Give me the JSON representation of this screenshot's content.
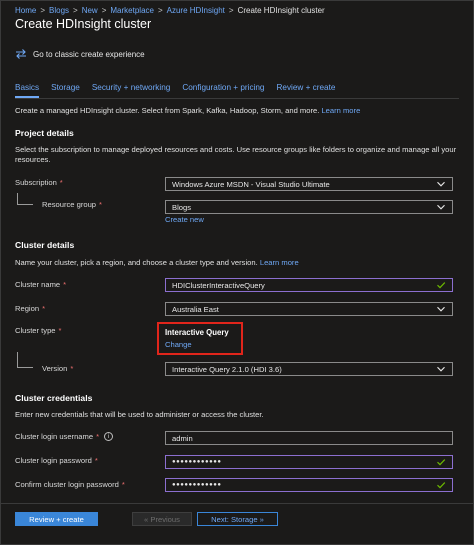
{
  "breadcrumb": {
    "items": [
      "Home",
      "Blogs",
      "New",
      "Marketplace",
      "Azure HDInsight"
    ],
    "current": "Create HDInsight cluster",
    "separator": ">"
  },
  "page_title": "Create HDInsight cluster",
  "classic_link": {
    "label": "Go to classic create experience",
    "icon": "swap-arrows-icon"
  },
  "tabs": [
    {
      "label": "Basics",
      "active": true
    },
    {
      "label": "Storage"
    },
    {
      "label": "Security + networking"
    },
    {
      "label": "Configuration + pricing"
    },
    {
      "label": "Review + create"
    }
  ],
  "intro": {
    "text": "Create a managed HDInsight cluster. Select from Spark, Kafka, Hadoop, Storm, and more.",
    "link": "Learn more"
  },
  "project_details": {
    "title": "Project details",
    "description": "Select the subscription to manage deployed resources and costs. Use resource groups like folders to organize and manage all your resources.",
    "subscription": {
      "label": "Subscription",
      "required": "*",
      "value": "Windows Azure MSDN - Visual Studio Ultimate"
    },
    "resource_group": {
      "label": "Resource group",
      "required": "*",
      "value": "Blogs",
      "create_new": "Create new"
    }
  },
  "cluster_details": {
    "title": "Cluster details",
    "description": "Name your cluster, pick a region, and choose a cluster type and version.",
    "link": "Learn more",
    "cluster_name": {
      "label": "Cluster name",
      "required": "*",
      "value": "HDIClusterInteractiveQuery"
    },
    "region": {
      "label": "Region",
      "required": "*",
      "value": "Australia East"
    },
    "cluster_type": {
      "label": "Cluster type",
      "required": "*",
      "value": "Interactive Query",
      "change": "Change"
    },
    "version": {
      "label": "Version",
      "required": "*",
      "value": "Interactive Query 2.1.0 (HDI 3.6)"
    }
  },
  "cluster_credentials": {
    "title": "Cluster credentials",
    "description": "Enter new credentials that will be used to administer or access the cluster.",
    "login_username": {
      "label": "Cluster login username",
      "required": "*",
      "value": "admin"
    },
    "login_password": {
      "label": "Cluster login password",
      "required": "*",
      "value": "●●●●●●●●●●●●"
    },
    "confirm_password": {
      "label": "Confirm cluster login password",
      "required": "*",
      "value": "●●●●●●●●●●●●"
    }
  },
  "footer": {
    "review_create": "Review + create",
    "previous": "« Previous",
    "next": "Next: Storage »"
  },
  "colors": {
    "background": "#1b1a19",
    "accent_link": "#6fa8f5",
    "primary_button": "#3a86d8",
    "valid_border": "#8c6fd0",
    "valid_check": "#6bb700",
    "highlight_box": "#e1251b",
    "required": "#f07070"
  }
}
